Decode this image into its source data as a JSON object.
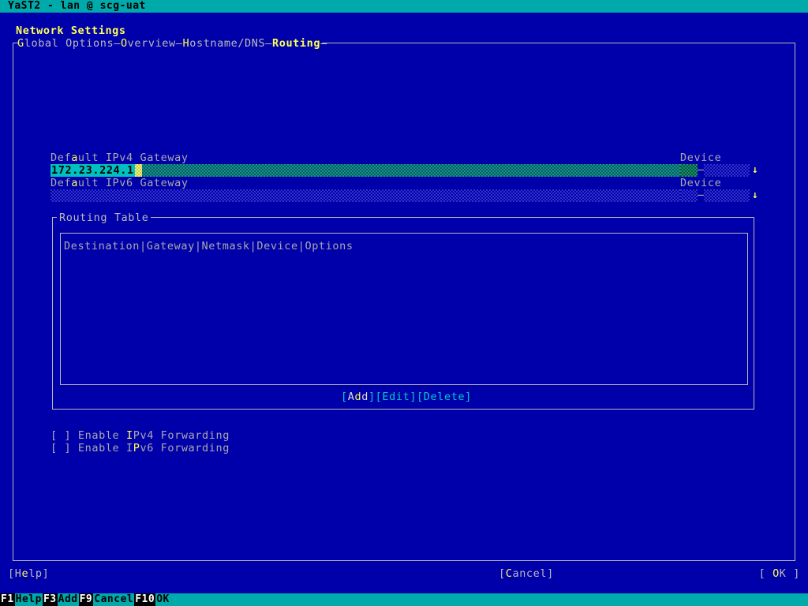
{
  "window": {
    "title": "YaST2 - lan @ scg-uat"
  },
  "page": {
    "title": "Network Settings"
  },
  "tabs": [
    {
      "label": "Global Options",
      "hotkey": "G",
      "active": false
    },
    {
      "label": "Overview",
      "hotkey": "O",
      "active": false
    },
    {
      "label": "Hostname/DNS",
      "hotkey": "H",
      "active": false
    },
    {
      "label": "Routing",
      "hotkey": "R",
      "active": true
    }
  ],
  "tab_separator": "—",
  "routing": {
    "ipv4_gateway": {
      "label": "Default IPv4 Gateway",
      "label_hotkey_index": 3,
      "value": "172.23.224.1",
      "placeholder": ""
    },
    "ipv4_device": {
      "label": "Device",
      "value": ""
    },
    "ipv6_gateway": {
      "label": "Default IPv6 Gateway",
      "label_hotkey_index": 3,
      "value": "",
      "placeholder": ""
    },
    "ipv6_device": {
      "label": "Device",
      "value": ""
    },
    "table": {
      "title": "Routing Table",
      "columns": [
        "Destination",
        "Gateway",
        "Netmask",
        "Device",
        "Options"
      ],
      "column_separator": "|",
      "rows": []
    },
    "table_buttons": [
      {
        "label": "Add",
        "hotkey": "d",
        "hotkey_index": 1
      },
      {
        "label": "Edit",
        "hotkey": "",
        "hotkey_index": -1
      },
      {
        "label": "Delete",
        "hotkey": "",
        "hotkey_index": -1
      }
    ],
    "checkboxes": [
      {
        "label": "Enable IPv4 Forwarding",
        "checked": false,
        "mark": "[ ]",
        "hotkey_char": "I",
        "hotkey_index": 7
      },
      {
        "label": "Enable IPv6 Forwarding",
        "checked": false,
        "mark": "[ ]",
        "hotkey_char": "P",
        "hotkey_index": 8
      }
    ]
  },
  "dialog_buttons": {
    "help": {
      "label": "Help",
      "bracket_left": "[",
      "bracket_right": "]",
      "hotkey_index": 1
    },
    "cancel": {
      "label": "Cancel",
      "bracket_left": "[",
      "bracket_right": "]",
      "hotkey_index": 0
    },
    "ok": {
      "label": "OK",
      "bracket_left": "[ ",
      "bracket_right": " ]",
      "hotkey_index": 0
    }
  },
  "function_keys": [
    {
      "key": "F1",
      "label": "Help"
    },
    {
      "key": "F3",
      "label": "Add"
    },
    {
      "key": "F9",
      "label": "Cancel"
    },
    {
      "key": "F10",
      "label": "OK"
    }
  ],
  "colors": {
    "background": "#0000aa",
    "titlebar_bg": "#00aaaa",
    "titlebar_fg": "#000000",
    "accent_yellow": "#ffff55",
    "text_gray": "#aaaaaa",
    "cyan_button": "#00cccc",
    "focus_field_bg": "#00c0c0",
    "border": "#bbbbbb"
  }
}
